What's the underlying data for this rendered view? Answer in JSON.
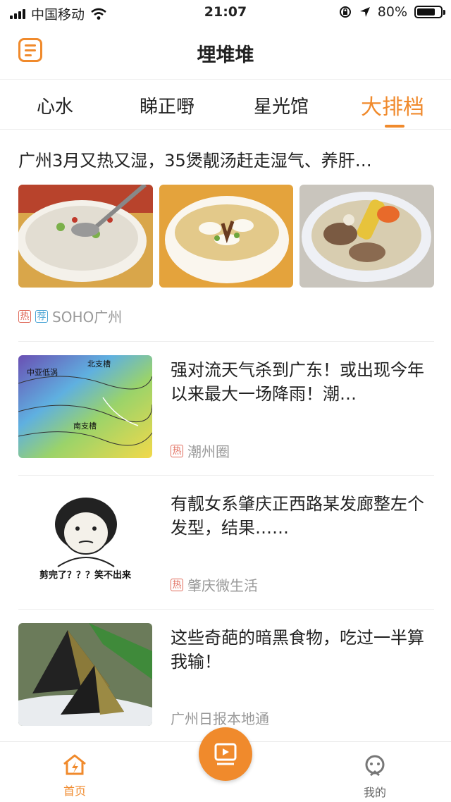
{
  "status": {
    "carrier": "中国移动",
    "time": "21:07",
    "battery": "80%",
    "battery_level": 0.8
  },
  "app": {
    "title": "埋堆堆"
  },
  "tabs": [
    {
      "label": "心水"
    },
    {
      "label": "睇正嘢"
    },
    {
      "label": "星光馆"
    },
    {
      "label": "大排档",
      "active": true
    }
  ],
  "feed": {
    "headline": {
      "title": "广州3月又热又湿，35煲靓汤赶走湿气、养肝…",
      "tag_hot": "热",
      "tag_rec": "荐",
      "source": "SOHO广州"
    },
    "items": [
      {
        "title": "强对流天气杀到广东！或出现今年以来最大一场降雨！潮…",
        "tag": "热",
        "source": "潮州圈",
        "image_labels": [
          "中亚低涡",
          "北支槽",
          "南支槽"
        ]
      },
      {
        "title": "有靓女系肇庆正西路某发廊整左个发型，结果……",
        "tag": "热",
        "source": "肇庆微生活",
        "image_caption": "剪完了？？？笑不出来"
      },
      {
        "title": "这些奇葩的暗黑食物，吃过一半算我输！",
        "source": "广州日报本地通"
      }
    ]
  },
  "bottom_nav": {
    "home": "首页",
    "mine": "我的"
  },
  "colors": {
    "accent": "#f08a2c",
    "hot_tag": "#e06a5a",
    "rec_tag": "#4da6d6"
  }
}
